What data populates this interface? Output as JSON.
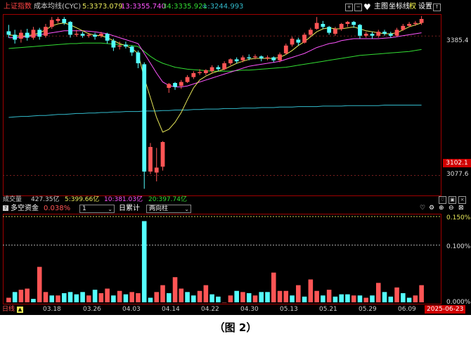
{
  "header": {
    "index_name": "上证指数",
    "indicator_name": "成本均线(CYC)",
    "ma5": "5:3373.079",
    "ma13": "13:3355.740",
    "ma34": "34:3335.921",
    "ma_inf": "∞:3244.993",
    "tools": {
      "main_label": "主图",
      "coord_label": "坐标线",
      "weight_label": "权",
      "settings_label": "设置"
    }
  },
  "price_axis": {
    "top_value": "3385.4",
    "high_box": "3102.1",
    "low_value": "3077.6"
  },
  "volume_bar": {
    "label": "成交量",
    "total": "427.35亿",
    "ma5": "5:399.66亿",
    "ma10": "10:381.03亿",
    "ma20": "20:397.74亿"
  },
  "sub_indicator": {
    "name": "多空资金",
    "value": "0.038%",
    "period_select": "1",
    "accum_label": "日累计",
    "direction_select": "两向柱",
    "axis": [
      "0.150%",
      "0.100%",
      "0.000%"
    ]
  },
  "bottom": {
    "period_tab": "日线",
    "dates": [
      "03.18",
      "03.26",
      "04.03",
      "04.14",
      "04.22",
      "04.30",
      "05.13",
      "05.21",
      "05.29",
      "06.09"
    ],
    "current_date": "2025-06-23"
  },
  "caption": "（图 2）",
  "colors": {
    "up": "#ff5555",
    "down": "#54ffff",
    "ma5": "#e8e85a",
    "ma13": "#ff55ff",
    "ma34": "#33dd33",
    "ma_inf": "#33bbcc",
    "frame": "#a00000"
  },
  "chart_data": [
    {
      "type": "candlestick",
      "description_series": [
        "ma5",
        "ma13",
        "ma34",
        "ma_inf"
      ],
      "ylim": [
        3060,
        3430
      ],
      "candles": [
        [
          3395,
          3388,
          3408,
          3382
        ],
        [
          3388,
          3378,
          3398,
          3370
        ],
        [
          3380,
          3392,
          3398,
          3372
        ],
        [
          3392,
          3382,
          3400,
          3376
        ],
        [
          3382,
          3398,
          3404,
          3378
        ],
        [
          3398,
          3384,
          3402,
          3378
        ],
        [
          3386,
          3404,
          3410,
          3382
        ],
        [
          3404,
          3418,
          3424,
          3400
        ],
        [
          3416,
          3420,
          3424,
          3412
        ],
        [
          3420,
          3412,
          3424,
          3408
        ],
        [
          3414,
          3388,
          3416,
          3382
        ],
        [
          3388,
          3390,
          3398,
          3384
        ],
        [
          3390,
          3386,
          3394,
          3382
        ],
        [
          3386,
          3388,
          3392,
          3382
        ],
        [
          3388,
          3384,
          3392,
          3378
        ],
        [
          3386,
          3390,
          3394,
          3382
        ],
        [
          3390,
          3376,
          3392,
          3370
        ],
        [
          3376,
          3362,
          3380,
          3355
        ],
        [
          3364,
          3366,
          3374,
          3358
        ],
        [
          3368,
          3364,
          3374,
          3360
        ],
        [
          3364,
          3352,
          3366,
          3345
        ],
        [
          3352,
          3330,
          3356,
          3320
        ],
        [
          3328,
          3110,
          3332,
          3075
        ],
        [
          3110,
          3160,
          3168,
          3105
        ],
        [
          3108,
          3118,
          3158,
          3090
        ],
        [
          3120,
          3170,
          3172,
          3112
        ],
        [
          3280,
          3288,
          3290,
          3270
        ],
        [
          3290,
          3282,
          3292,
          3276
        ],
        [
          3284,
          3292,
          3296,
          3278
        ],
        [
          3292,
          3302,
          3306,
          3290
        ],
        [
          3302,
          3310,
          3314,
          3298
        ],
        [
          3310,
          3312,
          3318,
          3306
        ],
        [
          3310,
          3316,
          3318,
          3306
        ],
        [
          3314,
          3322,
          3326,
          3310
        ],
        [
          3322,
          3318,
          3326,
          3314
        ],
        [
          3318,
          3330,
          3334,
          3316
        ],
        [
          3330,
          3338,
          3340,
          3326
        ],
        [
          3338,
          3334,
          3342,
          3330
        ],
        [
          3336,
          3342,
          3346,
          3332
        ],
        [
          3342,
          3340,
          3348,
          3336
        ],
        [
          3342,
          3344,
          3348,
          3338
        ],
        [
          3344,
          3340,
          3346,
          3334
        ],
        [
          3340,
          3342,
          3346,
          3336
        ],
        [
          3342,
          3336,
          3344,
          3332
        ],
        [
          3336,
          3348,
          3352,
          3332
        ],
        [
          3350,
          3366,
          3370,
          3348
        ],
        [
          3368,
          3380,
          3384,
          3364
        ],
        [
          3378,
          3372,
          3382,
          3366
        ],
        [
          3372,
          3388,
          3392,
          3370
        ],
        [
          3388,
          3398,
          3402,
          3384
        ],
        [
          3400,
          3412,
          3424,
          3398
        ],
        [
          3410,
          3404,
          3416,
          3400
        ],
        [
          3404,
          3392,
          3406,
          3388
        ],
        [
          3390,
          3400,
          3404,
          3386
        ],
        [
          3400,
          3410,
          3412,
          3396
        ],
        [
          3410,
          3414,
          3416,
          3404
        ],
        [
          3414,
          3408,
          3416,
          3402
        ],
        [
          3408,
          3386,
          3410,
          3380
        ],
        [
          3386,
          3390,
          3394,
          3382
        ],
        [
          3390,
          3386,
          3394,
          3380
        ],
        [
          3386,
          3394,
          3398,
          3382
        ],
        [
          3394,
          3390,
          3398,
          3386
        ],
        [
          3390,
          3386,
          3394,
          3382
        ],
        [
          3386,
          3398,
          3402,
          3384
        ],
        [
          3398,
          3406,
          3410,
          3396
        ],
        [
          3406,
          3410,
          3414,
          3404
        ],
        [
          3410,
          3412,
          3416,
          3406
        ],
        [
          3412,
          3420,
          3426,
          3408
        ]
      ],
      "ma5": [
        3388,
        3386,
        3385,
        3386,
        3388,
        3392,
        3398,
        3406,
        3410,
        3412,
        3408,
        3402,
        3396,
        3390,
        3387,
        3386,
        3382,
        3376,
        3370,
        3366,
        3360,
        3350,
        3300,
        3260,
        3220,
        3190,
        3196,
        3210,
        3230,
        3256,
        3280,
        3296,
        3304,
        3310,
        3314,
        3318,
        3324,
        3330,
        3334,
        3338,
        3340,
        3340,
        3340,
        3340,
        3342,
        3348,
        3356,
        3366,
        3374,
        3384,
        3394,
        3400,
        3402,
        3400,
        3400,
        3402,
        3404,
        3400,
        3396,
        3394,
        3392,
        3390,
        3390,
        3392,
        3398,
        3404,
        3408,
        3412
      ],
      "ma13": [
        3382,
        3382,
        3383,
        3384,
        3386,
        3388,
        3390,
        3392,
        3394,
        3396,
        3396,
        3396,
        3396,
        3395,
        3394,
        3392,
        3390,
        3386,
        3382,
        3378,
        3374,
        3370,
        3350,
        3330,
        3310,
        3292,
        3285,
        3282,
        3282,
        3284,
        3288,
        3292,
        3296,
        3300,
        3304,
        3308,
        3312,
        3316,
        3320,
        3324,
        3326,
        3328,
        3330,
        3332,
        3334,
        3338,
        3342,
        3346,
        3350,
        3356,
        3362,
        3366,
        3370,
        3372,
        3376,
        3378,
        3380,
        3380,
        3380,
        3380,
        3380,
        3381,
        3382,
        3384,
        3386,
        3388,
        3390,
        3392
      ],
      "ma34": [
        3360,
        3361,
        3362,
        3363,
        3364,
        3365,
        3366,
        3367,
        3368,
        3369,
        3370,
        3370,
        3371,
        3371,
        3371,
        3371,
        3370,
        3369,
        3368,
        3367,
        3366,
        3364,
        3354,
        3344,
        3336,
        3330,
        3326,
        3322,
        3320,
        3318,
        3317,
        3316,
        3315,
        3314,
        3314,
        3314,
        3314,
        3315,
        3316,
        3316,
        3317,
        3318,
        3319,
        3320,
        3321,
        3322,
        3324,
        3326,
        3328,
        3330,
        3332,
        3334,
        3336,
        3338,
        3340,
        3342,
        3344,
        3346,
        3347,
        3348,
        3349,
        3350,
        3351,
        3352,
        3353,
        3354,
        3356,
        3358
      ],
      "ma_inf": [
        3220,
        3221,
        3222,
        3222,
        3223,
        3224,
        3224,
        3225,
        3226,
        3226,
        3227,
        3228,
        3228,
        3229,
        3229,
        3230,
        3230,
        3231,
        3231,
        3232,
        3232,
        3232,
        3233,
        3233,
        3233,
        3234,
        3234,
        3235,
        3235,
        3235,
        3236,
        3236,
        3237,
        3237,
        3237,
        3238,
        3238,
        3238,
        3239,
        3239,
        3239,
        3240,
        3240,
        3240,
        3241,
        3241,
        3241,
        3242,
        3242,
        3242,
        3242,
        3243,
        3243,
        3243,
        3243,
        3244,
        3244,
        3244,
        3244,
        3244,
        3244,
        3245,
        3245,
        3245,
        3245,
        3245,
        3245,
        3245
      ]
    },
    {
      "type": "bar",
      "ylabel": "多空资金",
      "ylim": [
        0,
        0.15
      ],
      "values": [
        0.008,
        0.018,
        0.022,
        0.024,
        0.006,
        0.062,
        0.018,
        0.012,
        0.012,
        0.016,
        0.018,
        0.014,
        0.018,
        0.012,
        0.022,
        0.016,
        0.024,
        0.012,
        0.02,
        0.014,
        0.018,
        0.016,
        0.142,
        0.008,
        0.018,
        0.03,
        0.016,
        0.044,
        0.024,
        0.018,
        0.012,
        0.02,
        0.03,
        0.014,
        0.01,
        0.0,
        0.012,
        0.02,
        0.018,
        0.016,
        0.012,
        0.018,
        0.018,
        0.052,
        0.02,
        0.02,
        0.012,
        0.03,
        0.01,
        0.04,
        0.02,
        0.012,
        0.022,
        0.01,
        0.014,
        0.014,
        0.012,
        0.012,
        0.008,
        0.012,
        0.034,
        0.018,
        0.01,
        0.026,
        0.016,
        0.008,
        0.012,
        0.03
      ],
      "signs": [
        1,
        -1,
        1,
        1,
        -1,
        1,
        1,
        -1,
        1,
        -1,
        -1,
        -1,
        -1,
        1,
        -1,
        1,
        1,
        -1,
        1,
        -1,
        1,
        1,
        -1,
        -1,
        1,
        1,
        -1,
        1,
        1,
        -1,
        -1,
        1,
        1,
        -1,
        -1,
        1,
        1,
        -1,
        1,
        -1,
        1,
        -1,
        -1,
        1,
        1,
        1,
        -1,
        1,
        -1,
        1,
        1,
        -1,
        1,
        -1,
        -1,
        -1,
        1,
        -1,
        1,
        -1,
        1,
        -1,
        -1,
        1,
        -1,
        -1,
        1,
        1
      ]
    }
  ]
}
